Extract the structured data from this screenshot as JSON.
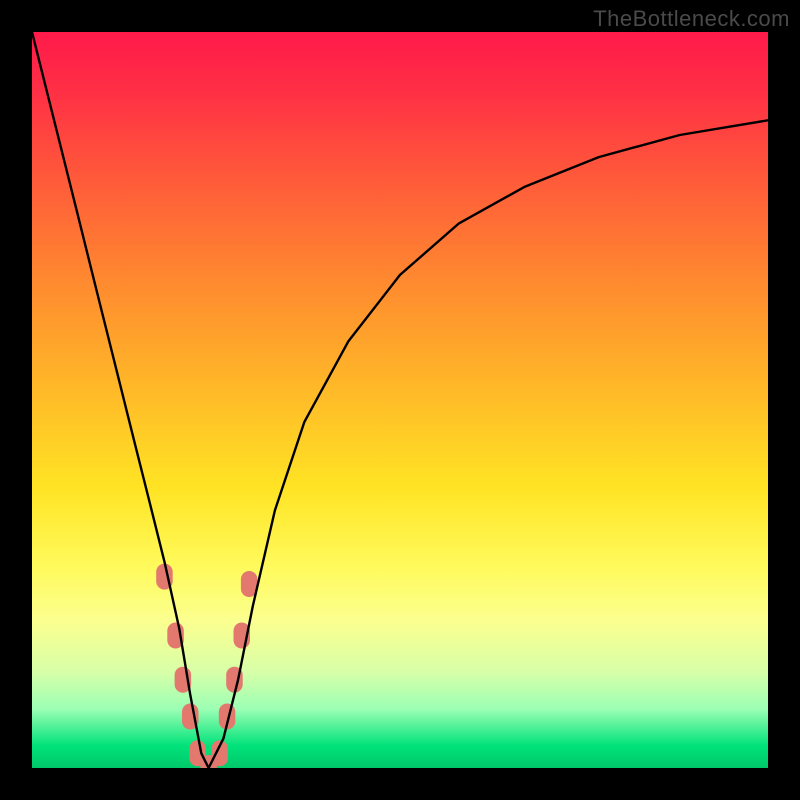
{
  "watermark": "TheBottleneck.com",
  "colors": {
    "frame": "#000000",
    "curve": "#000000",
    "marker": "#e2786e",
    "gradient": [
      "#ff1a4a",
      "#ff5a3a",
      "#ffb728",
      "#ffe424",
      "#fbff8f",
      "#00e27a"
    ]
  },
  "chart_data": {
    "type": "line",
    "title": "",
    "xlabel": "",
    "ylabel": "",
    "xlim": [
      0,
      100
    ],
    "ylim": [
      0,
      100
    ],
    "grid": false,
    "legend": false,
    "note": "Curve approximates a bottleneck V-shape; y≈0 is best (green), y≈100 is worst (red). x is an unlabeled parameter sweep (e.g. resolution or workload). Values are estimated from pixel positions.",
    "series": [
      {
        "name": "left-branch",
        "x": [
          0,
          3,
          6,
          9,
          12,
          14,
          16,
          18,
          20,
          21.5,
          23,
          24
        ],
        "y": [
          100,
          88,
          76,
          64,
          52,
          44,
          36,
          28,
          19,
          10,
          2,
          0
        ]
      },
      {
        "name": "right-branch",
        "x": [
          24,
          26,
          28,
          30,
          33,
          37,
          43,
          50,
          58,
          67,
          77,
          88,
          100
        ],
        "y": [
          0,
          4,
          12,
          22,
          35,
          47,
          58,
          67,
          74,
          79,
          83,
          86,
          88
        ]
      }
    ],
    "markers": {
      "name": "highlighted-points",
      "note": "Salmon capsule/dot markers clustered near the valley on both branches, roughly in the y=0–25 band.",
      "points": [
        {
          "x": 18.0,
          "y": 26
        },
        {
          "x": 19.5,
          "y": 18
        },
        {
          "x": 20.5,
          "y": 12
        },
        {
          "x": 21.5,
          "y": 7
        },
        {
          "x": 22.5,
          "y": 2
        },
        {
          "x": 24.0,
          "y": 0
        },
        {
          "x": 25.5,
          "y": 2
        },
        {
          "x": 26.5,
          "y": 7
        },
        {
          "x": 27.5,
          "y": 12
        },
        {
          "x": 28.5,
          "y": 18
        },
        {
          "x": 29.5,
          "y": 25
        }
      ]
    }
  }
}
